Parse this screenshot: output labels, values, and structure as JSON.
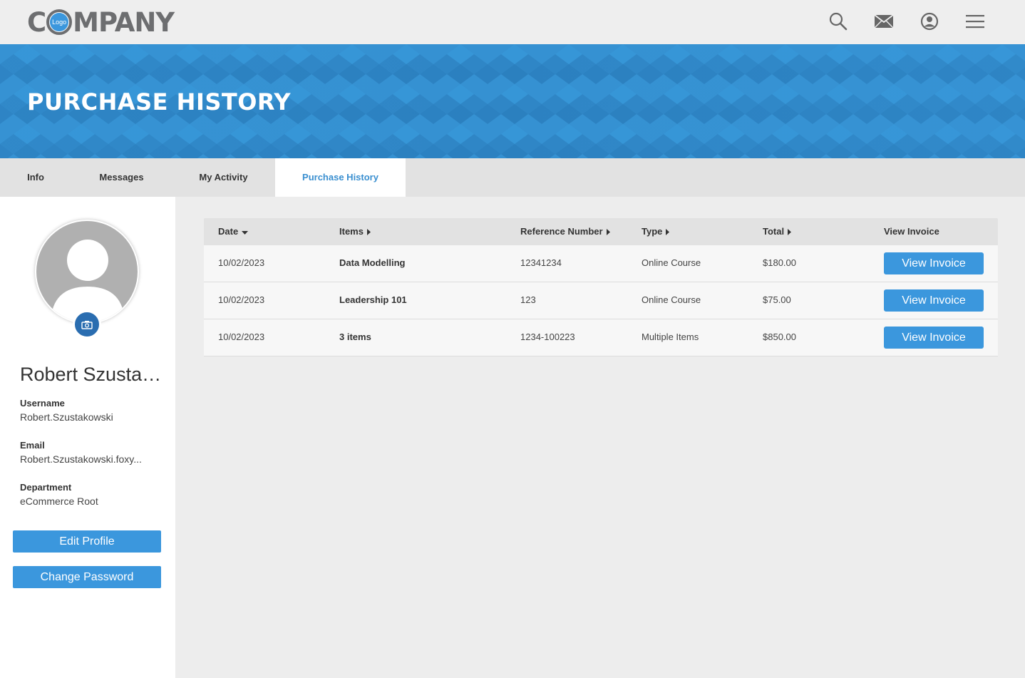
{
  "header": {
    "logo_text_left": "C",
    "logo_badge": "Logo",
    "logo_text_right": "MPANY",
    "icons": [
      "search-icon",
      "mail-icon",
      "account-icon",
      "menu-icon"
    ]
  },
  "banner": {
    "title": "PURCHASE HISTORY"
  },
  "tabs": [
    {
      "label": "Info",
      "active": false
    },
    {
      "label": "Messages",
      "active": false
    },
    {
      "label": "My Activity",
      "active": false
    },
    {
      "label": "Purchase History",
      "active": true
    }
  ],
  "profile": {
    "name": "Robert Szustakowski",
    "username_label": "Username",
    "username": "Robert.Szustakowski",
    "email_label": "Email",
    "email": "Robert.Szustakowski.foxy...",
    "department_label": "Department",
    "department": "eCommerce Root",
    "edit_profile_label": "Edit Profile",
    "change_password_label": "Change Password"
  },
  "table": {
    "columns": [
      {
        "label": "Date",
        "sort": "desc"
      },
      {
        "label": "Items",
        "sort": "none"
      },
      {
        "label": "Reference Number",
        "sort": "none"
      },
      {
        "label": "Type",
        "sort": "none"
      },
      {
        "label": "Total",
        "sort": "none"
      },
      {
        "label": "View Invoice",
        "sort": null
      }
    ],
    "rows": [
      {
        "date": "10/02/2023",
        "items": "Data Modelling",
        "reference": "12341234",
        "type": "Online Course",
        "total": "$180.00",
        "button": "View Invoice"
      },
      {
        "date": "10/02/2023",
        "items": "Leadership 101",
        "reference": "123",
        "type": "Online Course",
        "total": "$75.00",
        "button": "View Invoice"
      },
      {
        "date": "10/02/2023",
        "items": "3 items",
        "reference": "1234-100223",
        "type": "Multiple Items",
        "total": "$850.00",
        "button": "View Invoice"
      }
    ]
  },
  "colors": {
    "accent": "#3b97dd",
    "banner": "#3591d2",
    "active_tab_text": "#3a8fd0"
  }
}
